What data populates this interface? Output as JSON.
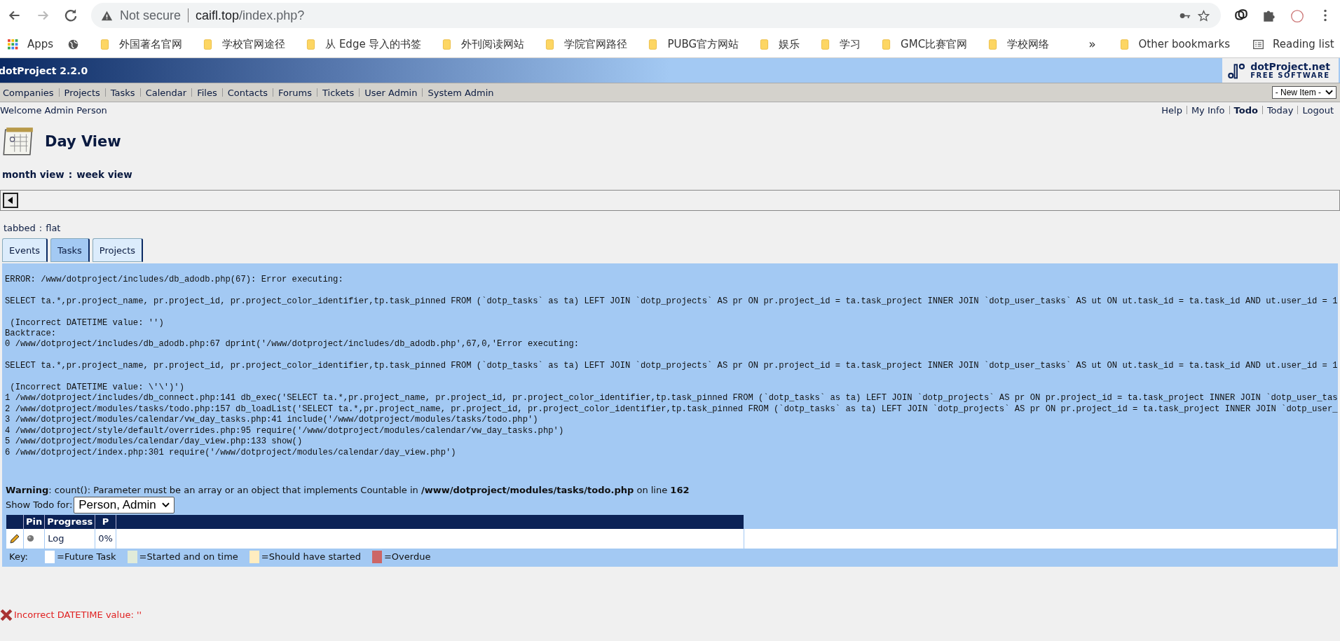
{
  "browser": {
    "security": "Not secure",
    "url_host": "caifl.top",
    "url_path": "/index.php?",
    "back_enabled": true,
    "forward_enabled": false
  },
  "bookmarks": [
    {
      "label": "Apps",
      "kind": "apps"
    },
    {
      "kind": "globe"
    },
    {
      "label": "外国著名官网",
      "kind": "folder"
    },
    {
      "label": "学校官网途径",
      "kind": "folder"
    },
    {
      "label": "从 Edge 导入的书签",
      "kind": "folder"
    },
    {
      "label": "外刊阅读网站",
      "kind": "folder"
    },
    {
      "label": "学院官网路径",
      "kind": "folder"
    },
    {
      "label": "PUBG官方网站",
      "kind": "folder"
    },
    {
      "label": "娱乐",
      "kind": "folder"
    },
    {
      "label": "学习",
      "kind": "folder"
    },
    {
      "label": "GMC比赛官网",
      "kind": "folder"
    },
    {
      "label": "学校网络",
      "kind": "folder"
    }
  ],
  "bookmarks_more": "»",
  "other_bookmarks": "Other bookmarks",
  "reading_list": "Reading list",
  "app": {
    "title": "dotProject 2.2.0",
    "logo_name": "dotProject.net",
    "logo_tagline": "FREE SOFTWARE"
  },
  "nav": [
    "Companies",
    "Projects",
    "Tasks",
    "Calendar",
    "Files",
    "Contacts",
    "Forums",
    "Tickets",
    "User Admin",
    "System Admin"
  ],
  "new_item": "- New Item -",
  "welcome": "Welcome Admin Person",
  "user_links": [
    {
      "label": "Help",
      "bold": false
    },
    {
      "label": "My Info",
      "bold": false
    },
    {
      "label": "Todo",
      "bold": true
    },
    {
      "label": "Today",
      "bold": false
    },
    {
      "label": "Logout",
      "bold": false
    }
  ],
  "page_title": "Day View",
  "view_links": [
    "month view",
    "week view"
  ],
  "view_separator": ":",
  "display_links": [
    "tabbed",
    "flat"
  ],
  "display_separator": ":",
  "tabs": [
    {
      "label": "Events",
      "selected": false
    },
    {
      "label": "Tasks",
      "selected": true
    },
    {
      "label": "Projects",
      "selected": false
    }
  ],
  "error_output": "ERROR: /www/dotproject/includes/db_adodb.php(67): Error executing:\n\nSELECT ta.*,pr.project_name, pr.project_id, pr.project_color_identifier,tp.task_pinned FROM (`dotp_tasks` as ta) LEFT JOIN `dotp_projects` AS pr ON pr.project_id = ta.task_project INNER JOIN `dotp_user_tasks` AS ut ON ut.task_id = ta.task_id AND ut.user_id = 1\n\n (Incorrect DATETIME value: '')\nBacktrace:\n0 /www/dotproject/includes/db_adodb.php:67 dprint('/www/dotproject/includes/db_adodb.php',67,0,'Error executing:\n\nSELECT ta.*,pr.project_name, pr.project_id, pr.project_color_identifier,tp.task_pinned FROM (`dotp_tasks` as ta) LEFT JOIN `dotp_projects` AS pr ON pr.project_id = ta.task_project INNER JOIN `dotp_user_tasks` AS ut ON ut.task_id = ta.task_id AND ut.user_id = 1\n\n (Incorrect DATETIME value: \\'\\')')\n1 /www/dotproject/includes/db_connect.php:141 db_exec('SELECT ta.*,pr.project_name, pr.project_id, pr.project_color_identifier,tp.task_pinned FROM (`dotp_tasks` as ta) LEFT JOIN `dotp_projects` AS pr ON pr.project_id = ta.task_project INNER JOIN `dotp_user_tas\n2 /www/dotproject/modules/tasks/todo.php:157 db_loadList('SELECT ta.*,pr.project_name, pr.project_id, pr.project_color_identifier,tp.task_pinned FROM (`dotp_tasks` as ta) LEFT JOIN `dotp_projects` AS pr ON pr.project_id = ta.task_project INNER JOIN `dotp_user_\n3 /www/dotproject/modules/calendar/vw_day_tasks.php:41 include('/www/dotproject/modules/tasks/todo.php')\n4 /www/dotproject/style/default/overrides.php:95 require('/www/dotproject/modules/calendar/vw_day_tasks.php')\n5 /www/dotproject/modules/calendar/day_view.php:133 show()\n6 /www/dotproject/index.php:301 require('/www/dotproject/modules/calendar/day_view.php')",
  "warning": "**Warning**: count(): Parameter must be an array or an object that implements Countable in **/www/dotproject/modules/tasks/todo.php** on line **162**",
  "show_todo_label": "Show Todo for:",
  "show_todo_value": "Person, Admin",
  "task_columns": [
    "",
    "Pin",
    "Progress",
    "P"
  ],
  "task_rows": [
    {
      "log": "Log",
      "progress": "0%"
    }
  ],
  "key_label": "Key:",
  "key": [
    {
      "label": "=Future Task",
      "color": "#ffffff"
    },
    {
      "label": "=Started and on time",
      "color": "#e0ebd9"
    },
    {
      "label": "=Should have started",
      "color": "#ffedc0"
    },
    {
      "label": "=Overdue",
      "color": "#cc6666"
    }
  ],
  "message": "Incorrect DATETIME value: ''"
}
